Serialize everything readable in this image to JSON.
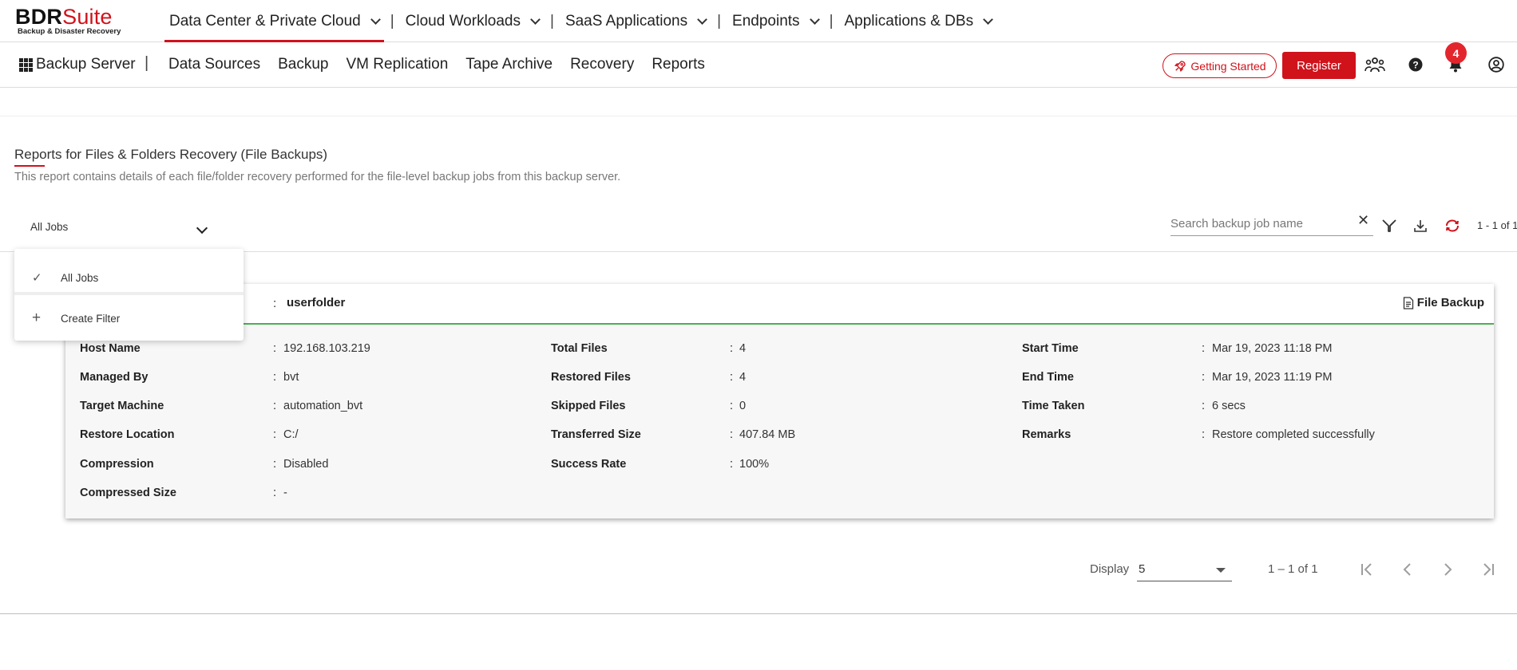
{
  "brand": {
    "name_bold": "BDR",
    "name_light": "Suite",
    "tagline": "Backup & Disaster Recovery"
  },
  "top_nav": [
    {
      "label": "Data Center & Private Cloud",
      "active": true
    },
    {
      "label": "Cloud Workloads",
      "active": false
    },
    {
      "label": "SaaS Applications",
      "active": false
    },
    {
      "label": "Endpoints",
      "active": false
    },
    {
      "label": "Applications & DBs",
      "active": false
    }
  ],
  "top_nav_separator": "|",
  "sub_bar": {
    "server_label": "Backup Server",
    "separator": "|",
    "items": [
      "Data Sources",
      "Backup",
      "VM Replication",
      "Tape Archive",
      "Recovery",
      "Reports"
    ],
    "getting_started": "Getting Started",
    "register": "Register",
    "notification_count": "4",
    "icons": [
      "rocket-icon",
      "community-icon",
      "help-icon",
      "bell-icon",
      "user-icon"
    ]
  },
  "report": {
    "title": "Reports for Files & Folders Recovery (File Backups)",
    "description": "This report contains details of each file/folder recovery performed for the file-level backup jobs from this backup server."
  },
  "filter": {
    "selected": "All Jobs",
    "search_placeholder": "Search backup job name",
    "search_clear": "✕",
    "page_count": "1 - 1 of 1",
    "menu": [
      {
        "label": "All Jobs",
        "icon": "✓"
      },
      {
        "label": "Create Filter",
        "icon": "+"
      }
    ]
  },
  "card": {
    "colon": ":",
    "job_name": "userfolder",
    "type_label": "File Backup",
    "col1": [
      {
        "label": "Host Name",
        "value": "192.168.103.219"
      },
      {
        "label": "Managed By",
        "value": "bvt"
      },
      {
        "label": "Target Machine",
        "value": "automation_bvt"
      },
      {
        "label": "Restore Location",
        "value": "C:/"
      },
      {
        "label": "Compression",
        "value": "Disabled"
      },
      {
        "label": "Compressed Size",
        "value": "-"
      }
    ],
    "col2": [
      {
        "label": "Total Files",
        "value": "4"
      },
      {
        "label": "Restored Files",
        "value": "4"
      },
      {
        "label": "Skipped Files",
        "value": "0"
      },
      {
        "label": "Transferred Size",
        "value": "407.84 MB"
      },
      {
        "label": "Success Rate",
        "value": "100%"
      }
    ],
    "col3": [
      {
        "label": "Start Time",
        "value": "Mar 19, 2023 11:18 PM"
      },
      {
        "label": "End Time",
        "value": "Mar 19, 2023 11:19 PM"
      },
      {
        "label": "Time Taken",
        "value": "6 secs"
      },
      {
        "label": "Remarks",
        "value": "Restore completed successfully"
      }
    ]
  },
  "pagination": {
    "display_label": "Display",
    "page_size": "5",
    "range": "1 – 1 of 1",
    "buttons": [
      "|‹",
      "‹",
      "›",
      "›|"
    ]
  },
  "colors": {
    "accent": "#d0121b",
    "success": "#4caf50",
    "badge": "#e3262e"
  }
}
